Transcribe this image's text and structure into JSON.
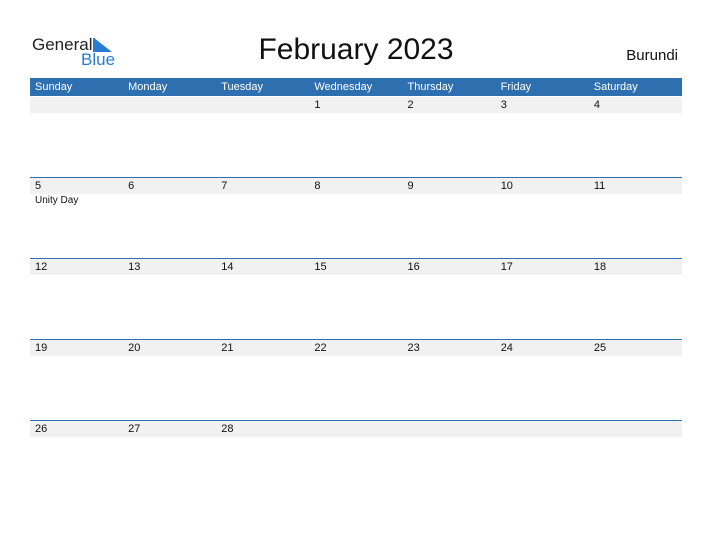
{
  "logo": {
    "general": "General",
    "blue": "Blue"
  },
  "header": {
    "title": "February 2023",
    "country": "Burundi"
  },
  "colors": {
    "accent": "#2e6fb0",
    "band": "#f1f1f1",
    "logo_blue": "#2a7bd3"
  },
  "weekdays": [
    "Sunday",
    "Monday",
    "Tuesday",
    "Wednesday",
    "Thursday",
    "Friday",
    "Saturday"
  ],
  "weeks": [
    {
      "days": [
        "",
        "",
        "",
        "1",
        "2",
        "3",
        "4"
      ],
      "holidays": [
        "",
        "",
        "",
        "",
        "",
        "",
        ""
      ]
    },
    {
      "days": [
        "5",
        "6",
        "7",
        "8",
        "9",
        "10",
        "11"
      ],
      "holidays": [
        "Unity Day",
        "",
        "",
        "",
        "",
        "",
        ""
      ]
    },
    {
      "days": [
        "12",
        "13",
        "14",
        "15",
        "16",
        "17",
        "18"
      ],
      "holidays": [
        "",
        "",
        "",
        "",
        "",
        "",
        ""
      ]
    },
    {
      "days": [
        "19",
        "20",
        "21",
        "22",
        "23",
        "24",
        "25"
      ],
      "holidays": [
        "",
        "",
        "",
        "",
        "",
        "",
        ""
      ]
    },
    {
      "days": [
        "26",
        "27",
        "28",
        "",
        "",
        "",
        ""
      ],
      "holidays": [
        "",
        "",
        "",
        "",
        "",
        "",
        ""
      ]
    }
  ]
}
